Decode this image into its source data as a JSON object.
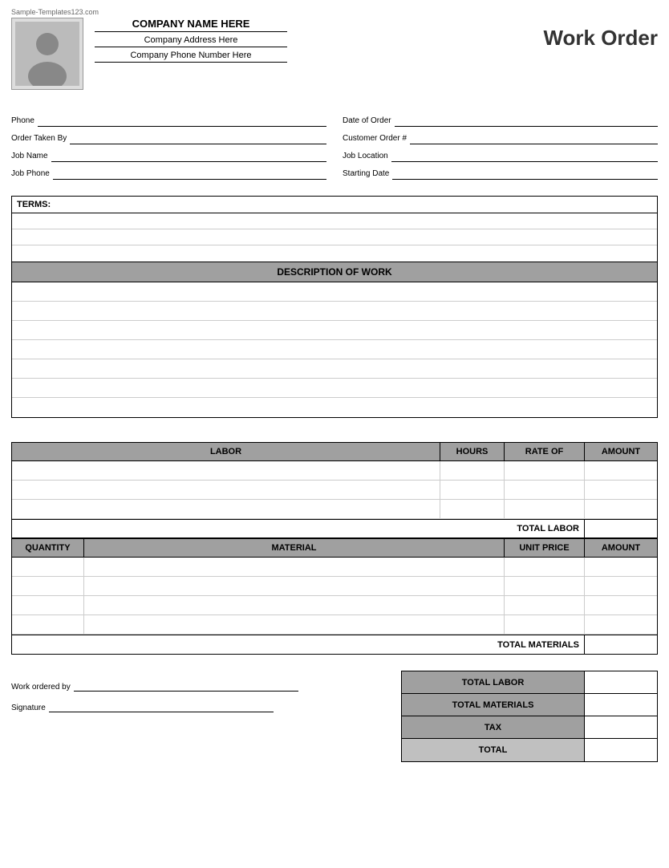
{
  "watermark": "Sample-Templates123.com",
  "header": {
    "company_name": "COMPANY NAME HERE",
    "company_address": "Company Address Here",
    "company_phone": "Company Phone Number Here",
    "title": "Work Order"
  },
  "form": {
    "left": [
      {
        "label": "Phone",
        "id": "phone"
      },
      {
        "label": "Order Taken By",
        "id": "order-taken-by"
      },
      {
        "label": "Job Name",
        "id": "job-name"
      },
      {
        "label": "Job Phone",
        "id": "job-phone"
      }
    ],
    "right": [
      {
        "label": "Date of Order",
        "id": "date-of-order"
      },
      {
        "label": "Customer Order #",
        "id": "customer-order"
      },
      {
        "label": "Job Location",
        "id": "job-location"
      },
      {
        "label": "Starting Date",
        "id": "starting-date"
      }
    ]
  },
  "terms": {
    "label": "TERMS:",
    "rows": 3
  },
  "description": {
    "header": "DESCRIPTION OF WORK",
    "rows": 7
  },
  "labor": {
    "columns": [
      "LABOR",
      "HOURS",
      "RATE OF",
      "AMOUNT"
    ],
    "rows": 3,
    "total_label": "TOTAL LABOR"
  },
  "materials": {
    "columns": [
      "QUANTITY",
      "MATERIAL",
      "UNIT PRICE",
      "AMOUNT"
    ],
    "rows": 4,
    "total_label": "TOTAL MATERIALS"
  },
  "summary": {
    "work_ordered_by_label": "Work ordered by",
    "signature_label": "Signature",
    "rows": [
      {
        "label": "TOTAL LABOR"
      },
      {
        "label": "TOTAL MATERIALS"
      },
      {
        "label": "TAX"
      },
      {
        "label": "TOTAL"
      }
    ]
  }
}
